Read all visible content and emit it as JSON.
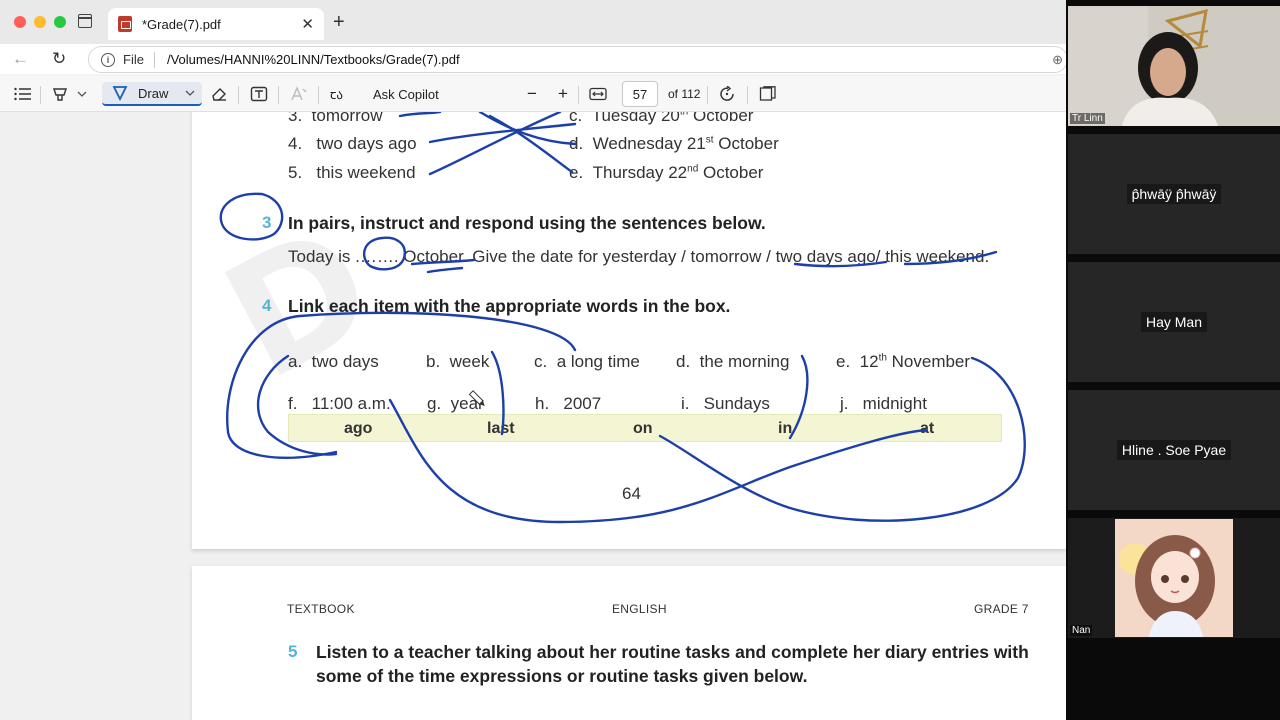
{
  "tab": {
    "title": "*Grade(7).pdf",
    "close": "✕",
    "new_tab": "+"
  },
  "address": {
    "scheme": "File",
    "url": "/Volumes/HANNI%20LINN/Textbooks/Grade(7).pdf"
  },
  "toolbar": {
    "draw_label": "Draw",
    "translate_label": "ꞇა",
    "ai_label": "Ask Copilot",
    "zoom_out": "−",
    "zoom_in": "+",
    "page_number": "57",
    "page_total": "of 112"
  },
  "page1": {
    "lines_top": [
      {
        "num": "3.",
        "text": "tomorrow"
      },
      {
        "num": "4.",
        "text": "two days ago"
      },
      {
        "num": "5.",
        "text": "this weekend"
      }
    ],
    "dates": [
      {
        "letter": "c.",
        "text": "Tuesday 20",
        "sup": "th",
        "tail": " October"
      },
      {
        "letter": "d.",
        "text": "Wednesday 21",
        "sup": "st",
        "tail": " October"
      },
      {
        "letter": "e.",
        "text": "Thursday 22",
        "sup": "nd",
        "tail": " October"
      }
    ],
    "ex3_num": "3",
    "ex3_title": "In pairs, instruct and respond using the sentences below.",
    "ex3_line_start": "Today is .",
    "ex3_dots": "……",
    "ex3_line_mid": ". ",
    "ex3_month": "October",
    "ex3_line_rest": ". Give the date for yesterday / tomorrow / ",
    "ex3_two_days": "two days ago",
    "ex3_slash": "/ ",
    "ex3_weekend": "this weekend",
    "ex3_end": ".",
    "ex4_num": "4",
    "ex4_title": "Link each item with the appropriate words in the box.",
    "items_row1": [
      {
        "letter": "a.",
        "text": "two days"
      },
      {
        "letter": "b.",
        "text": "week"
      },
      {
        "letter": "c.",
        "text": "a long time"
      },
      {
        "letter": "d.",
        "text": "the morning"
      },
      {
        "letter": "e.",
        "text": "12",
        "sup": "th",
        "tail": " November"
      }
    ],
    "items_row2": [
      {
        "letter": "f.",
        "text": "11:00 a.m."
      },
      {
        "letter": "g.",
        "text": "year"
      },
      {
        "letter": "h.",
        "text": "2007"
      },
      {
        "letter": "i.",
        "text": "Sundays"
      },
      {
        "letter": "j.",
        "text": "midnight"
      }
    ],
    "box_words": [
      "ago",
      "last",
      "on",
      "in",
      "at"
    ],
    "page_number": "64"
  },
  "page2": {
    "header_left": "TEXTBOOK",
    "header_center": "ENGLISH",
    "header_right": "GRADE 7",
    "ex5_num": "5",
    "ex5_line1": "Listen to a teacher talking about her routine tasks and complete her diary entries with",
    "ex5_line2": "some of the time expressions or routine tasks given below."
  },
  "participants": {
    "host_name": "Tr Linn",
    "tile2": "p̂hwāÿ p̂hwāÿ",
    "tile3": "Hay Man",
    "tile4": "Hline . Soe Pyae",
    "tile5": "Nan"
  },
  "colors": {
    "ink": "#1c3fa8",
    "accent_blue": "#1a5fb4",
    "exercise_number": "#55b3da",
    "answer_box": "#f4f5d3"
  }
}
